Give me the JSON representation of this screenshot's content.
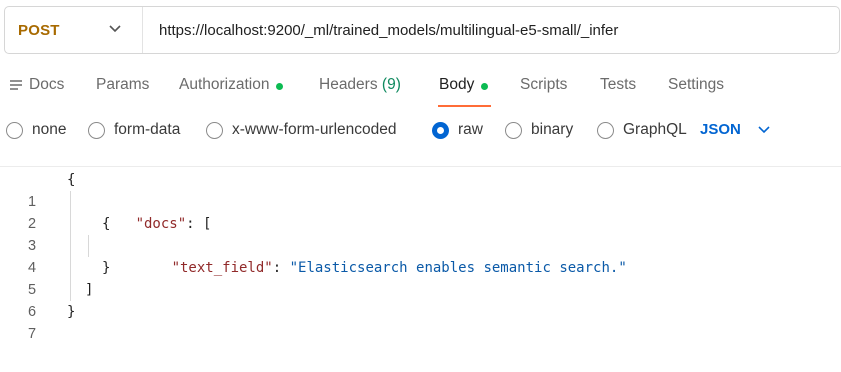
{
  "request": {
    "method": "POST",
    "url": "https://localhost:9200/_ml/trained_models/multilingual-e5-small/_infer"
  },
  "tabs": [
    {
      "label": "Docs",
      "icon": "docs-icon"
    },
    {
      "label": "Params"
    },
    {
      "label": "Authorization",
      "dot": true
    },
    {
      "label": "Headers",
      "count": "(9)"
    },
    {
      "label": "Body",
      "dot": true,
      "active": true
    },
    {
      "label": "Scripts"
    },
    {
      "label": "Tests"
    },
    {
      "label": "Settings"
    }
  ],
  "body_types": [
    {
      "label": "none",
      "checked": false
    },
    {
      "label": "form-data",
      "checked": false
    },
    {
      "label": "x-www-form-urlencoded",
      "checked": false
    },
    {
      "label": "raw",
      "checked": true
    },
    {
      "label": "binary",
      "checked": false
    },
    {
      "label": "GraphQL",
      "checked": false
    }
  ],
  "format": "JSON",
  "editor": {
    "line_numbers": [
      "1",
      "2",
      "3",
      "4",
      "5",
      "6",
      "7"
    ],
    "line1": "{",
    "line2_key": "\"docs\"",
    "line2_rest": ": [",
    "line3": "{",
    "line4_key": "\"text_field\"",
    "line4_colon": ": ",
    "line4_value": "\"Elasticsearch enables semantic search.\"",
    "line5": "}",
    "line6": "]",
    "line7": "}"
  },
  "colors": {
    "method": "#a86a00",
    "accent": "#ff6c37",
    "status_dot": "#0cbb52",
    "radio_checked": "#0265d2",
    "json_key": "#912a2a",
    "json_string": "#0b5aa8"
  }
}
